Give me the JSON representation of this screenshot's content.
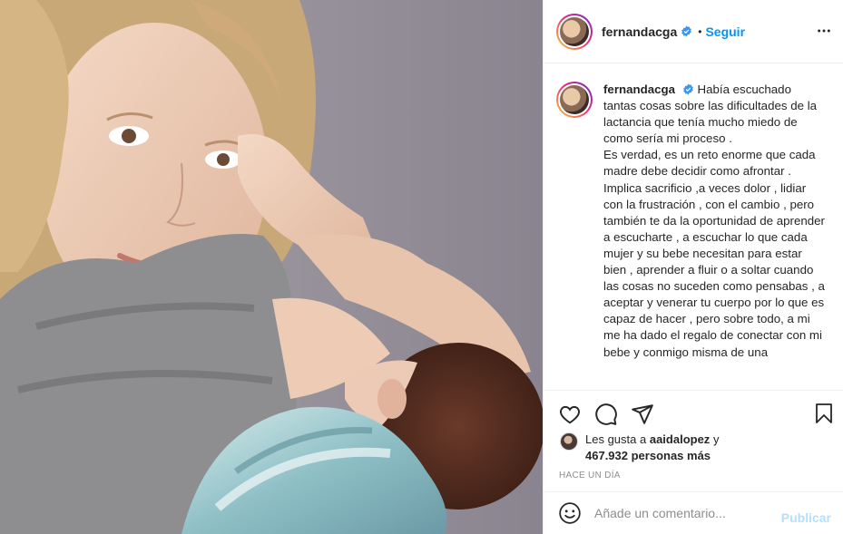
{
  "post": {
    "image": {
      "description_icon": "photo"
    },
    "author": {
      "username": "fernandacga",
      "follow_label": "Seguir",
      "separator": "•"
    },
    "caption": {
      "username": "fernandacga",
      "text": "Había escuchado tantas cosas sobre las dificultades de la lactancia que tenía mucho miedo de como sería mi proceso .\nEs verdad, es un reto enorme que cada madre debe decidir como afrontar .\nImplica sacrificio ,a veces dolor , lidiar con la frustración , con el cambio , pero también te da la oportunidad de aprender a escucharte , a escuchar lo que cada mujer y su bebe necesitan para estar bien , aprender a fluir o a soltar cuando las cosas no suceden como pensabas , a aceptar y venerar tu cuerpo por lo que es capaz de hacer , pero sobre todo, a mi me ha dado el regalo de conectar con mi bebe y conmigo misma de una"
    },
    "likes": {
      "prefix": "Les gusta a",
      "user": "aaidalopez",
      "connector": "y",
      "count_text": "467.932 personas más"
    },
    "time_ago": "HACE UN DÍA",
    "comment": {
      "placeholder": "Añade un comentario...",
      "publish_label": "Publicar"
    }
  },
  "icons": {
    "verified": "verified-badge-icon",
    "more": "more-options-icon",
    "like": "heart-icon",
    "comment": "comment-icon",
    "share": "share-icon",
    "save": "bookmark-icon",
    "emoji": "emoji-icon"
  },
  "colors": {
    "link_blue": "#0095f6",
    "verified_blue": "#3897f0",
    "muted_text": "#8e8e8e",
    "publish_disabled": "#b2dffc",
    "divider": "#efefef"
  }
}
